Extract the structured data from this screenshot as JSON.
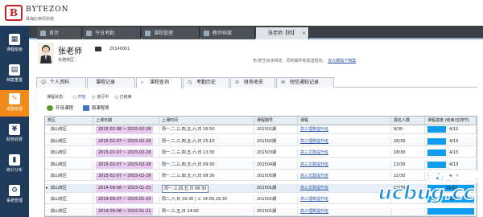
{
  "brand": {
    "name": "BYTEZON",
    "name_cn": "珠海比特讯科技"
  },
  "sidebar": {
    "items": [
      {
        "label": "课程班级",
        "icon": "class-icon"
      },
      {
        "label": "档案重置",
        "icon": "archive-icon"
      },
      {
        "label": "考勤管理",
        "icon": "attendance-icon",
        "active": true
      },
      {
        "label": "财务收费",
        "icon": "finance-icon"
      },
      {
        "label": "统计分析",
        "icon": "stats-icon"
      },
      {
        "label": "系统管理",
        "icon": "system-icon"
      }
    ]
  },
  "top_tabs": [
    {
      "label": "首页"
    },
    {
      "label": "今日考勤"
    },
    {
      "label": "课程管理"
    },
    {
      "label": "教师档案"
    },
    {
      "label": "张老师【师】",
      "selected": true,
      "close": "×"
    }
  ],
  "teacher": {
    "name": "张老师",
    "campus": "东莞校区",
    "id": "20140001"
  },
  "notice": {
    "text": "张/老生尚未绑定，同时邮件和发送短信。",
    "link": "去九朝鼎下档案"
  },
  "detail_tabs": [
    {
      "label": "个人资料",
      "icon": "person-icon"
    },
    {
      "label": "课程记录",
      "icon": "record-icon"
    },
    {
      "label": "课程查询",
      "icon": "search-icon",
      "selected": true
    },
    {
      "label": "考勤历史",
      "icon": "history-icon"
    },
    {
      "label": "财务收支",
      "icon": "money-icon"
    },
    {
      "label": "短信通知记录",
      "icon": "sms-icon"
    }
  ],
  "filter": {
    "label": "课程状态：",
    "options": [
      {
        "label": "○ 开班",
        "on": true
      },
      {
        "label": "○ 进行中",
        "on": false
      },
      {
        "label": "○ 已结束",
        "on": false
      }
    ]
  },
  "actions": {
    "start": "开设课程",
    "schedule": "周课程表"
  },
  "table": {
    "headers": [
      "校区",
      "上课日期",
      "上课时间",
      "课程期号",
      "课程",
      "报名人数",
      "课程进度 (结束/应排节)"
    ],
    "rows": [
      {
        "campus": "鼎山校区",
        "date": "2015-02-08 ~ 2015-02-28",
        "time": "周一,二,三,四,五,六,日 16:50",
        "period": "201501期",
        "course": "高三理数提升班",
        "count": "9/30",
        "progress": 0.4,
        "progress_text": "4/12"
      },
      {
        "campus": "鼎山校区",
        "date": "2015-02-07 ~ 2015-02-28",
        "time": "周一,二,三,四,五,六,日 15:10",
        "period": "201502期",
        "course": "高三理数提升班",
        "count": "26/30",
        "progress": 0.4,
        "progress_text": "4/13"
      },
      {
        "campus": "鼎山校区",
        "date": "2015-02-07 ~ 2015-02-28",
        "time": "周一,二,三,四,五,六,日 13:30",
        "period": "201503期",
        "course": "高三文数提升班",
        "count": "18/30",
        "progress": 0.4,
        "progress_text": "4/13"
      },
      {
        "campus": "鼎山校区",
        "date": "2015-02-07 ~ 2015-02-28",
        "time": "周一,二,三,四,五,六,日 09:30",
        "period": "201504期",
        "course": "高三文数提升班",
        "count": "13/30",
        "progress": 0.4,
        "progress_text": "4/13"
      },
      {
        "campus": "鼎山校区",
        "date": "2015-02-07 ~ 2015-02-28",
        "time": "周一,二,三,四,五,六,日 08:30",
        "period": "201505期",
        "course": "高三文数提升班",
        "count": "22/30",
        "progress": 0.4,
        "progress_text": "4/13"
      },
      {
        "campus": "鼎山校区",
        "date": "2014-09-08 ~ 2015-01-25",
        "time": "周一,三,四,五,日 08:30",
        "period": "201501期",
        "course": "高三文数提升班",
        "count": "13/30",
        "progress": 1.0,
        "progress_text": "21/21",
        "current": true
      },
      {
        "campus": "鼎山校区",
        "date": "2014-09-07 ~ 2015-01-24",
        "time": "周二,六,日 19:30 | 三 14:00,19:30",
        "period": "201501期",
        "course": "高三理数提升班",
        "count": "",
        "progress": 1.0,
        "progress_text": "21/21"
      },
      {
        "campus": "鼎山校区",
        "date": "2014-09-08 ~ 2015-01-21",
        "time": "周一,三,五,日 14:00",
        "period": "201501期",
        "course": "高三理数提升班",
        "count": "",
        "progress": 1.0,
        "progress_text": ""
      }
    ]
  },
  "watermark": {
    "line1": "软件下载站",
    "line2": "ucbug.cc"
  }
}
